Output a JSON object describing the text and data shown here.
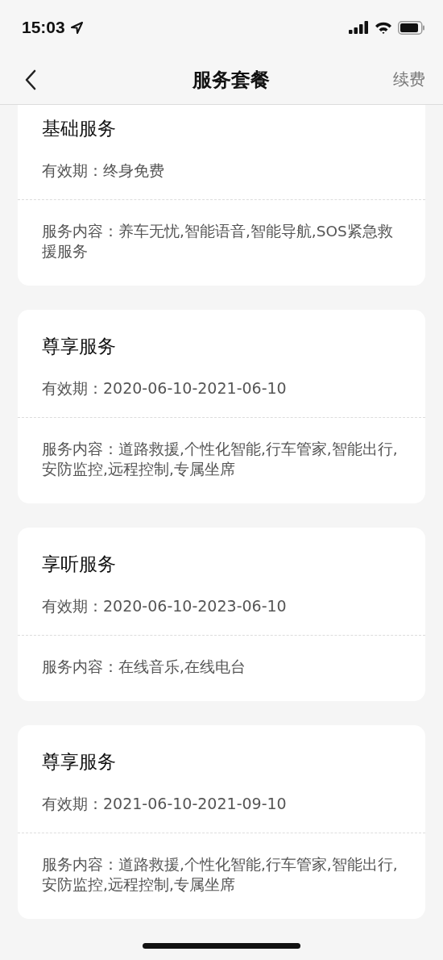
{
  "status_bar": {
    "time": "15:03"
  },
  "header": {
    "title": "服务套餐",
    "action": "续费"
  },
  "packages": [
    {
      "name": "基础服务",
      "validity": "有效期：终身免费",
      "content": "服务内容：养车无忧,智能语音,智能导航,SOS紧急救援服务"
    },
    {
      "name": "尊享服务",
      "validity": "有效期：2020-06-10-2021-06-10",
      "content": "服务内容：道路救援,个性化智能,行车管家,智能出行,安防监控,远程控制,专属坐席"
    },
    {
      "name": "享听服务",
      "validity": "有效期：2020-06-10-2023-06-10",
      "content": "服务内容：在线音乐,在线电台"
    },
    {
      "name": "尊享服务",
      "validity": "有效期：2021-06-10-2021-09-10",
      "content": "服务内容：道路救援,个性化智能,行车管家,智能出行,安防监控,远程控制,专属坐席"
    }
  ]
}
